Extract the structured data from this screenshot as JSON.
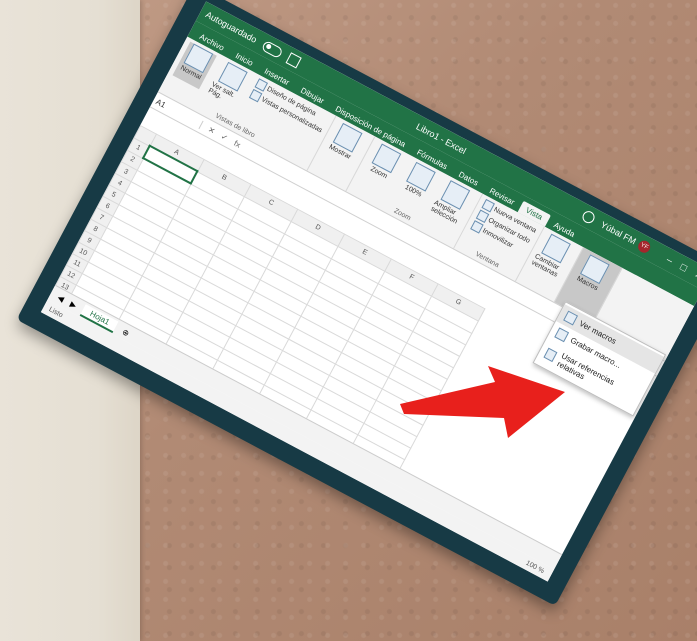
{
  "window": {
    "autosave_label": "Autoguardado",
    "title": "Libro1 - Excel",
    "user": "Yúbal FM",
    "user_initials": "YF"
  },
  "tabs": [
    "Archivo",
    "Inicio",
    "Insertar",
    "Dibujar",
    "Disposición de página",
    "Fórmulas",
    "Datos",
    "Revisar",
    "Vista",
    "Ayuda"
  ],
  "active_tab": "Vista",
  "ribbon": {
    "normal": "Normal",
    "ver_salto": "Ver salt. Pág.",
    "diseno_pagina": "Diseño de página",
    "vistas_personalizadas": "Vistas personalizadas",
    "vistas_label": "Vistas de libro",
    "mostrar": "Mostrar",
    "zoom": "Zoom",
    "zoom_100": "100%",
    "ampliar": "Ampliar selección",
    "zoom_group": "Zoom",
    "nueva_ventana": "Nueva ventana",
    "organizar_todo": "Organizar todo",
    "inmovilizar": "Inmovilizar",
    "ventana_group": "Ventana",
    "cambiar_ventanas": "Cambiar ventanas",
    "macros": "Macros"
  },
  "formula_bar": {
    "name_box": "A1"
  },
  "grid": {
    "columns": [
      "A",
      "B",
      "C",
      "D",
      "E",
      "F",
      "G"
    ],
    "rows": [
      "1",
      "2",
      "3",
      "4",
      "5",
      "6",
      "7",
      "8",
      "9",
      "10",
      "11",
      "12",
      "13",
      "14",
      "15"
    ]
  },
  "sheet_tab": "Hoja1",
  "status": {
    "left": "Listo",
    "zoom": "100 %"
  },
  "menu": {
    "items": [
      "Ver macros",
      "Grabar macro...",
      "Usar referencias relativas"
    ]
  },
  "colors": {
    "excel_green": "#217346",
    "arrow_red": "#e8201c"
  }
}
